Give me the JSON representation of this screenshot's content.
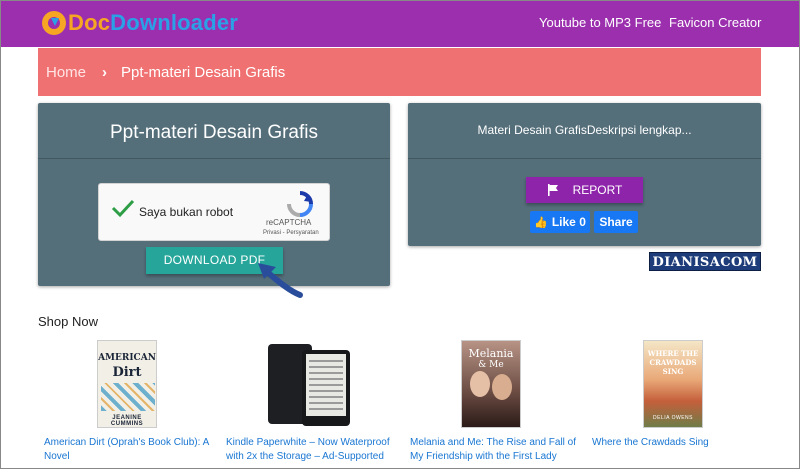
{
  "header": {
    "logo_doc": "Doc",
    "logo_downloader": "Downloader",
    "nav": [
      "Youtube to MP3 Free",
      "Favicon Creator"
    ],
    "bg_color": "#9b2fae"
  },
  "breadcrumb": {
    "home": "Home",
    "current": "Ppt-materi Desain Grafis",
    "bg_color": "#f07171"
  },
  "document_panel": {
    "title": "Ppt-materi Desain Grafis",
    "captcha": {
      "label": "Saya bukan robot",
      "brand": "reCAPTCHA",
      "terms": "Privasi - Persyaratan",
      "checked": true
    },
    "download_label": "DOWNLOAD PDF"
  },
  "info_panel": {
    "description": "Materi Desain GrafisDeskripsi lengkap...",
    "report_label": "REPORT",
    "like_label": "Like",
    "like_count": "0",
    "share_label": "Share"
  },
  "watermark": "DIANISACOM",
  "shop": {
    "title": "Shop Now",
    "products": [
      {
        "title": "American Dirt (Oprah's Book Club): A Novel",
        "cover_line1": "AMERICAN",
        "cover_line2": "Dirt",
        "cover_author": "JEANINE CUMMINS"
      },
      {
        "title": "Kindle Paperwhite – Now Waterproof with 2x the Storage – Ad-Supported"
      },
      {
        "title": "Melania and Me: The Rise and Fall of My Friendship with the First Lady",
        "cover_line1": "Melania",
        "cover_line2": "& Me"
      },
      {
        "title": "Where the Crawdads Sing",
        "cover_line1": "WHERE THE CRAWDADS SING",
        "cover_author": "DELIA OWENS"
      }
    ]
  },
  "colors": {
    "panel": "#546e7a",
    "download_button": "#26a69a",
    "report_button": "#8e24aa",
    "facebook": "#1877f2",
    "link": "#1976d2"
  }
}
